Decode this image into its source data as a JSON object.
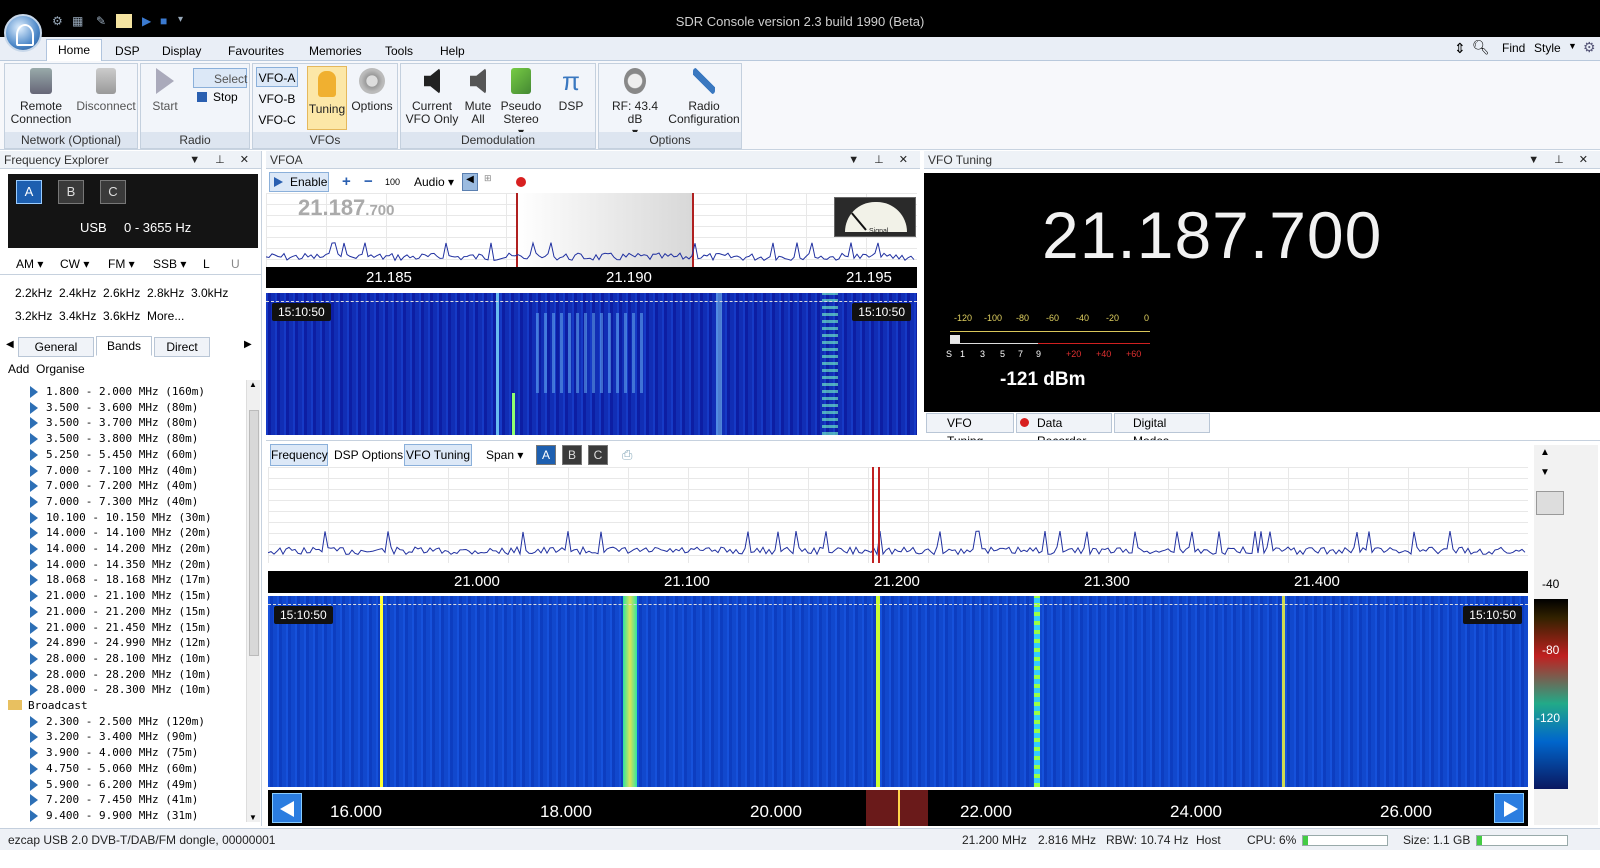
{
  "app": {
    "title": "SDR Console version 2.3 build 1990 (Beta)"
  },
  "menu": {
    "tabs": [
      "Home",
      "DSP",
      "Display",
      "Favourites",
      "Memories",
      "Tools",
      "Help"
    ],
    "right": {
      "find": "Find",
      "style": "Style"
    }
  },
  "ribbon": {
    "network": {
      "label": "Network (Optional)",
      "remote": [
        "Remote",
        "Connection"
      ],
      "disconnect": "Disconnect"
    },
    "radio": {
      "label": "Radio",
      "start": "Start",
      "select": "Select",
      "stop": "Stop"
    },
    "vfos": {
      "label": "VFOs",
      "a": "VFO-A",
      "b": "VFO-B",
      "c": "VFO-C",
      "tuning": "Tuning",
      "options": "Options"
    },
    "demod": {
      "label": "Demodulation",
      "current": [
        "Current",
        "VFO Only"
      ],
      "mute": [
        "Mute",
        "All"
      ],
      "pseudo": [
        "Pseudo",
        "Stereo"
      ],
      "dsp": "DSP"
    },
    "options": {
      "label": "Options",
      "rf": "RF: 43.4 dB",
      "radio_cfg": [
        "Radio",
        "Configuration"
      ]
    }
  },
  "freq_explorer": {
    "title": "Frequency Explorer",
    "vfo_buttons": [
      "A",
      "B",
      "C"
    ],
    "mode_text": "USB",
    "range_text": "0 - 3655 Hz",
    "modes": [
      "AM",
      "CW",
      "FM",
      "SSB",
      "L",
      "U"
    ],
    "bandwidths_row1": [
      "2.2kHz",
      "2.4kHz",
      "2.6kHz",
      "2.8kHz",
      "3.0kHz"
    ],
    "bandwidths_row2": [
      "3.2kHz",
      "3.4kHz",
      "3.6kHz",
      "More..."
    ],
    "tabs": [
      "General",
      "Bands",
      "Direct"
    ],
    "actions": [
      "Add",
      "Organise"
    ],
    "bands": [
      "1.800 - 2.000 MHz (160m)",
      "3.500 - 3.600 MHz (80m)",
      "3.500 - 3.700 MHz (80m)",
      "3.500 - 3.800 MHz (80m)",
      "5.250 - 5.450 MHz (60m)",
      "7.000 - 7.100 MHz (40m)",
      "7.000 - 7.200 MHz (40m)",
      "7.000 - 7.300 MHz (40m)",
      "10.100 - 10.150 MHz (30m)",
      "14.000 - 14.100 MHz (20m)",
      "14.000 - 14.200 MHz (20m)",
      "14.000 - 14.350 MHz (20m)",
      "18.068 - 18.168 MHz (17m)",
      "21.000 - 21.100 MHz (15m)",
      "21.000 - 21.200 MHz (15m)",
      "21.000 - 21.450 MHz (15m)",
      "24.890 - 24.990 MHz (12m)",
      "28.000 - 28.100 MHz (10m)",
      "28.000 - 28.200 MHz (10m)",
      "28.000 - 28.300 MHz (10m)"
    ],
    "folder": "Broadcast",
    "broadcast": [
      "2.300 - 2.500 MHz (120m)",
      "3.200 - 3.400 MHz (90m)",
      "3.900 - 4.000 MHz (75m)",
      "4.750 - 5.060 MHz (60m)",
      "5.900 - 6.200 MHz (49m)",
      "7.200 - 7.450 MHz (41m)",
      "9.400 - 9.900 MHz (31m)"
    ]
  },
  "vfoa": {
    "title": "VFOA",
    "enable": "Enable",
    "step": "100",
    "audio": "Audio",
    "freq_big": "21.187",
    "freq_small": ".700",
    "scale": [
      "21.185",
      "21.190",
      "21.195"
    ],
    "time_left": "15:10:50",
    "time_right": "15:10:50",
    "meter_label": "Signal"
  },
  "vfo_tuning": {
    "title": "VFO Tuning",
    "freq": "21.187.700",
    "scale_top": [
      "-120",
      "-100",
      "-80",
      "-60",
      "-40",
      "-20",
      "0"
    ],
    "scale_bottom": [
      "S",
      "1",
      "3",
      "5",
      "7",
      "9",
      "+20",
      "+40",
      "+60"
    ],
    "level": "-121 dBm",
    "tabs": [
      "VFO Tuning",
      "Data Recorder",
      "Digital Modes"
    ]
  },
  "main": {
    "toolbar": {
      "frequency": "Frequency",
      "dsp_options": "DSP Options",
      "vfo_tuning": "VFO Tuning",
      "span": "Span",
      "abc": [
        "A",
        "B",
        "C"
      ]
    },
    "scale": [
      "21.000",
      "21.100",
      "21.200",
      "21.300",
      "21.400"
    ],
    "time_left": "15:10:50",
    "time_right": "15:10:50",
    "bottom_scale": [
      "16.000",
      "18.000",
      "20.000",
      "22.000",
      "24.000",
      "26.000"
    ],
    "colorbar": [
      "-40",
      "-80",
      "-120"
    ]
  },
  "status": {
    "device": "ezcap USB 2.0 DVB-T/DAB/FM dongle, 00000001",
    "freq": "21.200 MHz",
    "rate": "2.816 MHz",
    "rbw": "RBW: 10.74 Hz",
    "host": "Host",
    "cpu": "CPU: 6%",
    "cpu_pct": 6,
    "size": "Size: 1.1 GB"
  }
}
